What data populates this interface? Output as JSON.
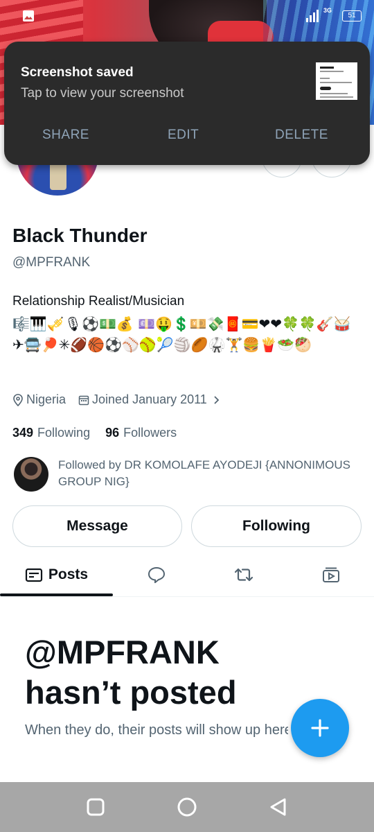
{
  "status_bar": {
    "network": "3G",
    "battery": "51"
  },
  "notification": {
    "title": "Screenshot saved",
    "subtitle": "Tap to view your screenshot",
    "actions": [
      "SHARE",
      "EDIT",
      "DELETE"
    ]
  },
  "profile": {
    "name": "Black Thunder",
    "handle": "@MPFRANK",
    "bio": "Relationship Realist/Musician",
    "bio_emojis": "🎼🎹🎺🎙⚽💵💰 💷🤑💲💴💸🧧💳❤❤🍀🍀🎸🥁✈🚍🏓✳🏈🏀⚽⚾🥎🎾🏐🏉🥋🏋🍔🍟🥗🥙",
    "location": "Nigeria",
    "joined": "Joined January 2011",
    "following_count": "349",
    "following_label": "Following",
    "followers_count": "96",
    "followers_label": "Followers",
    "followed_by": "Followed by DR KOMOLAFE AYODEJI {ANNONIMOUS GROUP NIG}"
  },
  "buttons": {
    "message": "Message",
    "following": "Following"
  },
  "tabs": [
    {
      "label": "Posts",
      "icon": "posts-icon",
      "active": true
    },
    {
      "label": "",
      "icon": "replies-icon"
    },
    {
      "label": "",
      "icon": "reposts-icon"
    },
    {
      "label": "",
      "icon": "media-icon"
    }
  ],
  "empty_state": {
    "title_line1": "@MPFRANK",
    "title_line2": "hasn’t posted",
    "subtitle": "When they do, their posts will show up here."
  },
  "colors": {
    "accent": "#1d9bf0",
    "notification_bg": "#2b2b2b",
    "navbar": "#a7a7a7"
  }
}
